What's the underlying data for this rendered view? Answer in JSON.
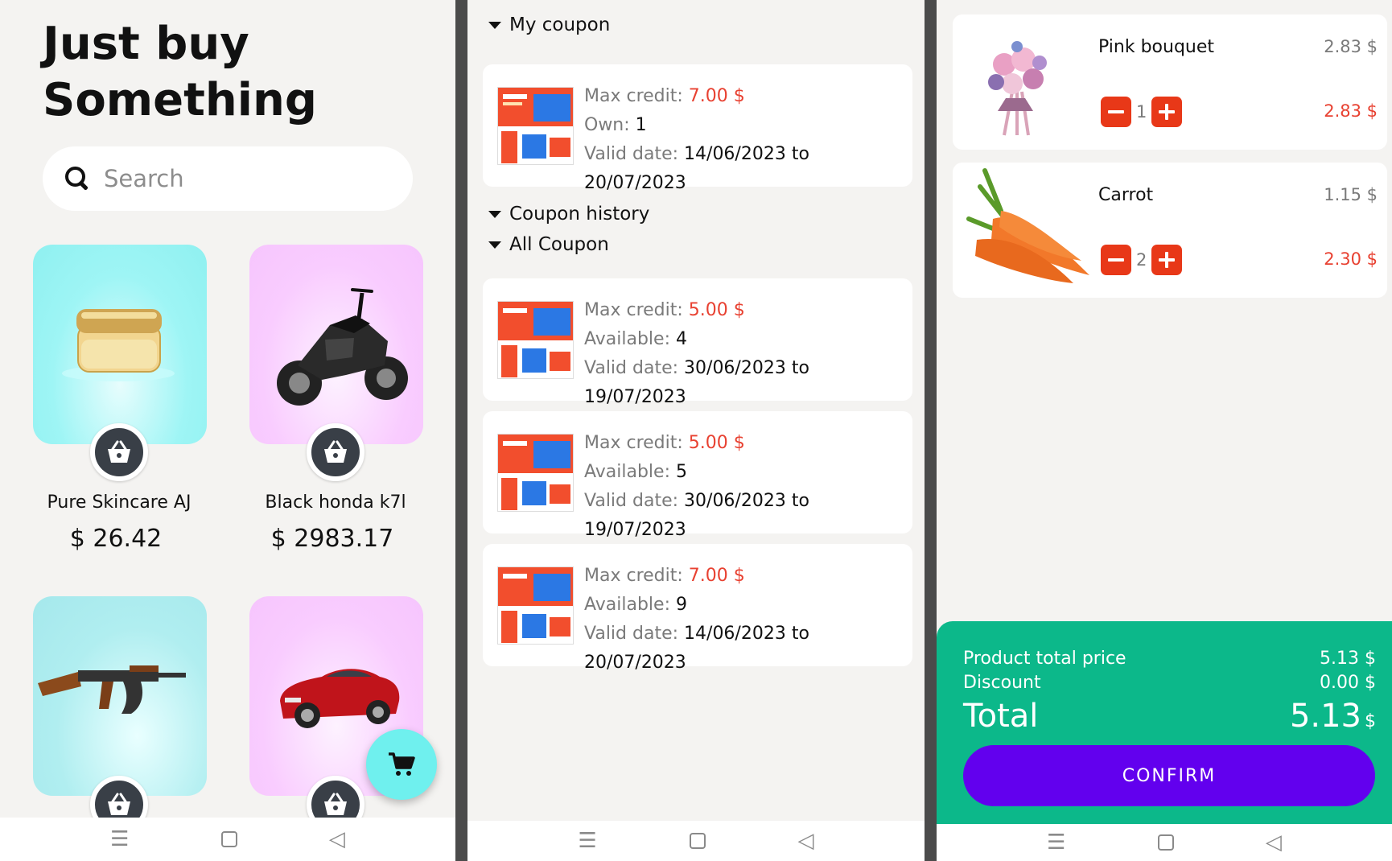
{
  "shop": {
    "title": "Just buy\nSomething",
    "search_placeholder": "Search",
    "products": [
      {
        "name": "Pure Skincare AJ",
        "price": "$ 26.42"
      },
      {
        "name": "Black honda k7l",
        "price": "$ 2983.17"
      },
      {
        "name": "",
        "price": ""
      },
      {
        "name": "",
        "price": ""
      }
    ]
  },
  "coupons": {
    "my_coupon_header": "My coupon",
    "coupon_history_header": "Coupon history",
    "all_coupon_header": "All Coupon",
    "labels": {
      "max_credit": "Max credit:",
      "own": "Own:",
      "available": "Available:",
      "valid_date": "Valid date:"
    },
    "my_coupon": {
      "max_credit": "7.00 $",
      "own": "1",
      "valid": "14/06/2023 to 20/07/2023"
    },
    "all": [
      {
        "max_credit": "5.00 $",
        "available": "4",
        "valid": "30/06/2023 to 19/07/2023"
      },
      {
        "max_credit": "5.00 $",
        "available": "5",
        "valid": "30/06/2023 to 19/07/2023"
      },
      {
        "max_credit": "7.00 $",
        "available": "9",
        "valid": "14/06/2023 to 20/07/2023"
      }
    ]
  },
  "cart": {
    "items": [
      {
        "name": "Pink bouquet",
        "unit_price": "2.83 $",
        "qty": "1",
        "line_price": "2.83 $"
      },
      {
        "name": "Carrot",
        "unit_price": "1.15 $",
        "qty": "2",
        "line_price": "2.30 $"
      }
    ],
    "product_total_label": "Product total price",
    "product_total_value": "5.13 $",
    "discount_label": "Discount",
    "discount_value": "0.00 $",
    "total_label": "Total",
    "total_value": "5.13",
    "total_unit": "$",
    "confirm_label": "CONFIRM"
  },
  "colors": {
    "accent_red": "#e84131",
    "summary_green": "#0cb88a",
    "confirm_purple": "#6200ee",
    "fab_cyan": "#6ff0ee"
  },
  "icons": [
    "search-icon",
    "basket-icon",
    "shopping-cart-icon",
    "minus-icon",
    "plus-icon",
    "caret-down-icon",
    "menu-icon",
    "home-square-icon",
    "back-triangle-icon"
  ]
}
